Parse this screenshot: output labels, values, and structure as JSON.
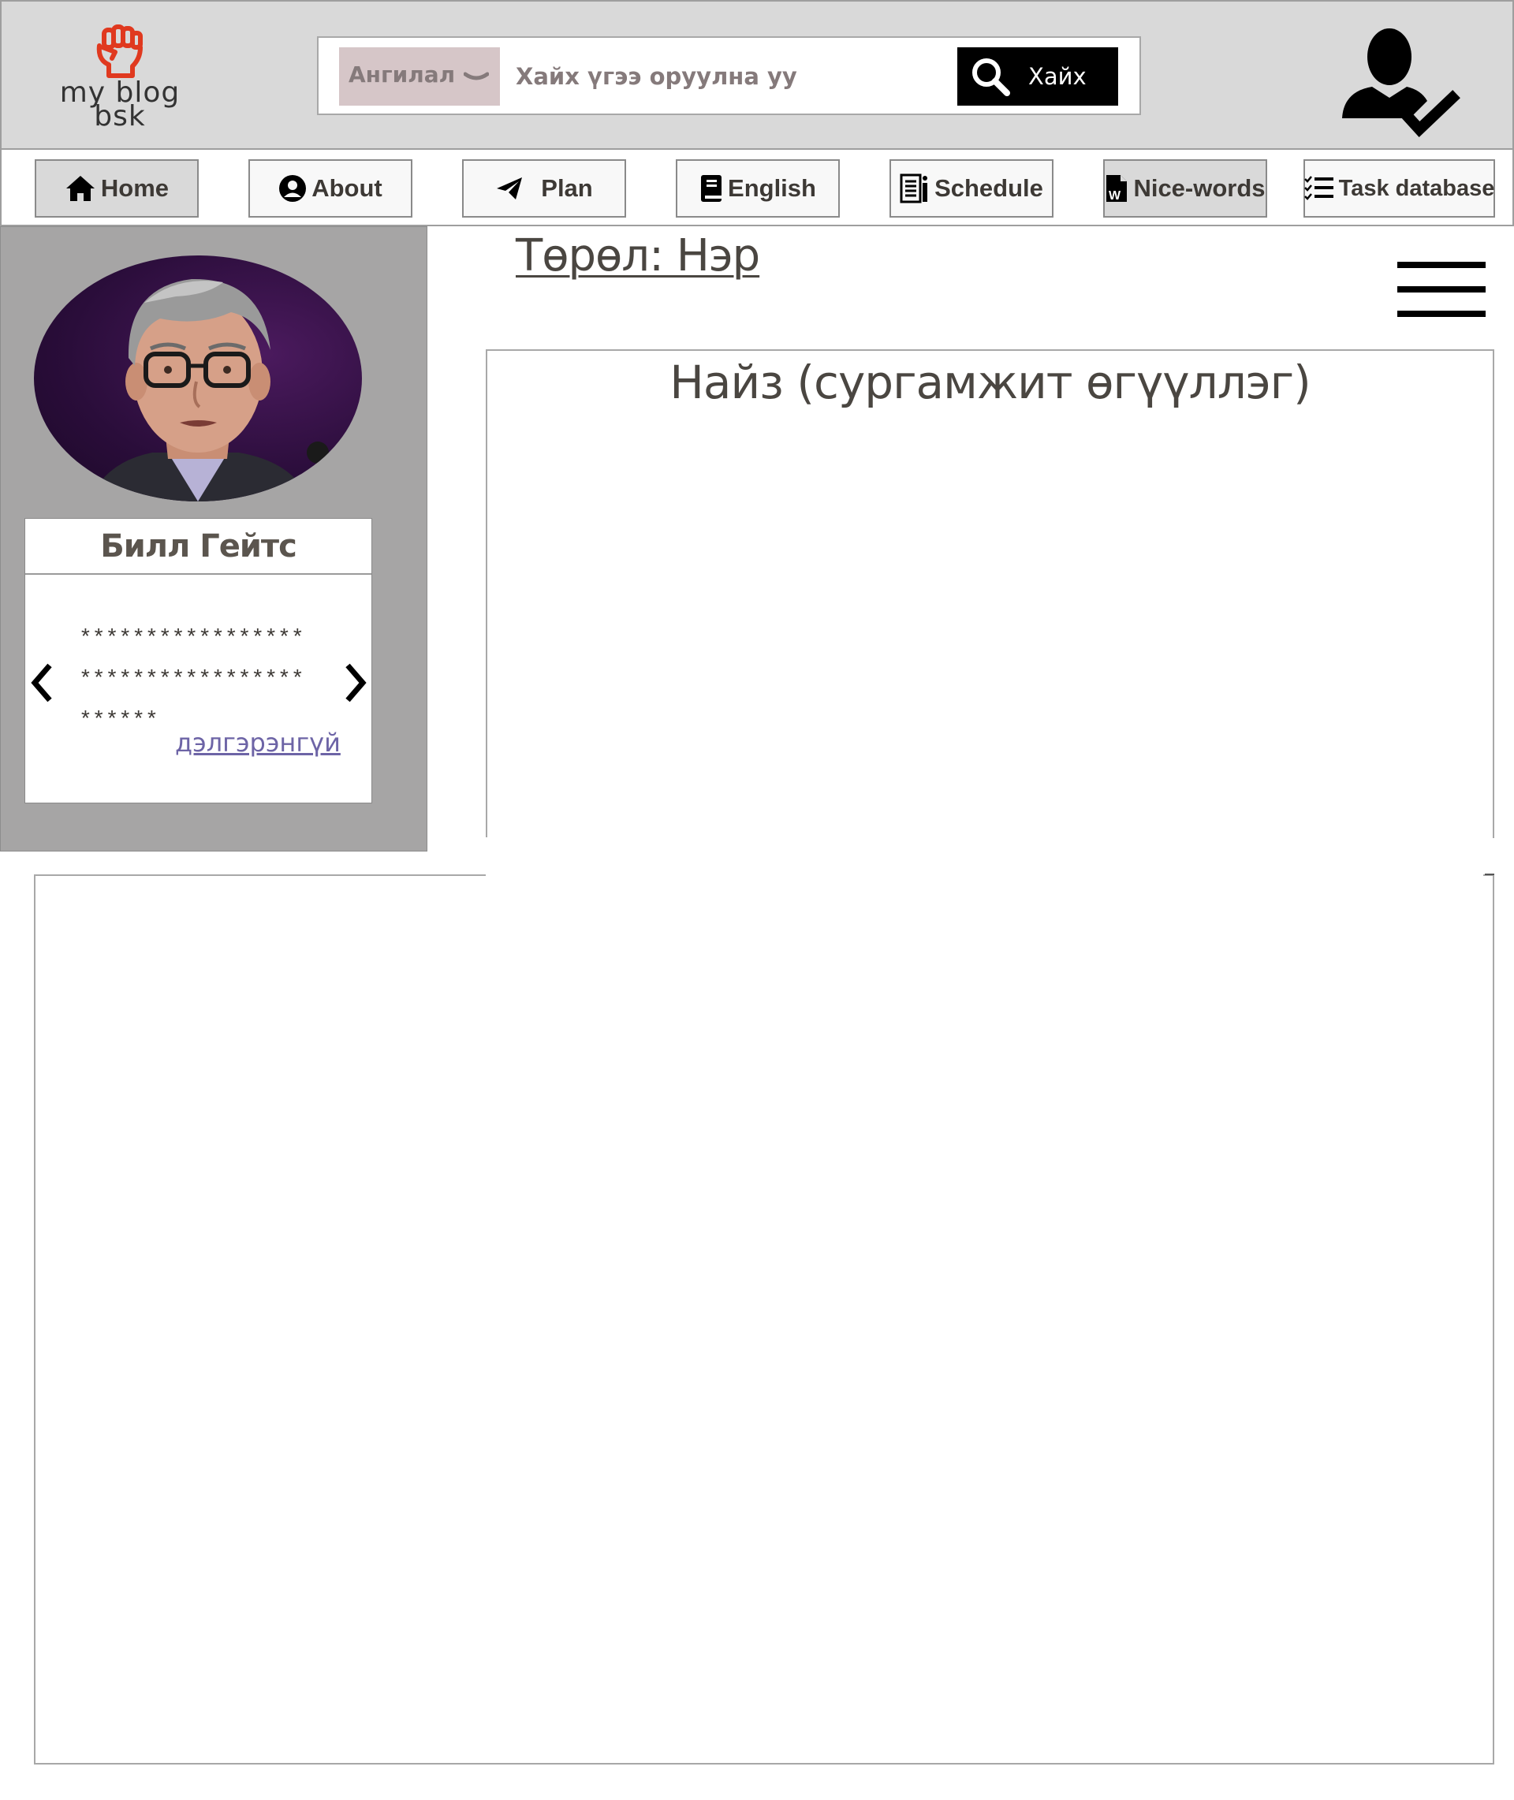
{
  "logo": {
    "line1": "my blog",
    "line2": "bsk",
    "icon": "raised-fist-icon",
    "icon_color": "#e0391f"
  },
  "search": {
    "category_label": "Ангилал",
    "placeholder": "Хайх үгээ оруулна уу",
    "button_label": "Хайх"
  },
  "user": {
    "icon": "user-verified-icon"
  },
  "nav": {
    "items": [
      {
        "label": "Home",
        "icon": "home-icon"
      },
      {
        "label": "About",
        "icon": "user-circle-icon"
      },
      {
        "label": "Plan",
        "icon": "paper-plane-icon"
      },
      {
        "label": "English",
        "icon": "book-icon"
      },
      {
        "label": "Schedule",
        "icon": "document-list-icon"
      },
      {
        "label": "Nice-words",
        "icon": "word-file-icon"
      },
      {
        "label": "Task database",
        "icon": "checklist-icon"
      }
    ],
    "active": [
      "Home",
      "Nice-words"
    ]
  },
  "profile": {
    "name": "Билл Гейтс",
    "text_line1": "*****************",
    "text_line2": "*****************",
    "text_line3": "******",
    "more_link": "дэлгэрэнгүй"
  },
  "main": {
    "genre_title": "Төрөл: Нэр",
    "content_title": "Найз (сургамжит өгүүллэг)"
  },
  "colors": {
    "header_bg": "#d9d9d9",
    "panel_bg": "#a6a5a5",
    "link": "#6d64a6",
    "accent": "#e0391f"
  }
}
